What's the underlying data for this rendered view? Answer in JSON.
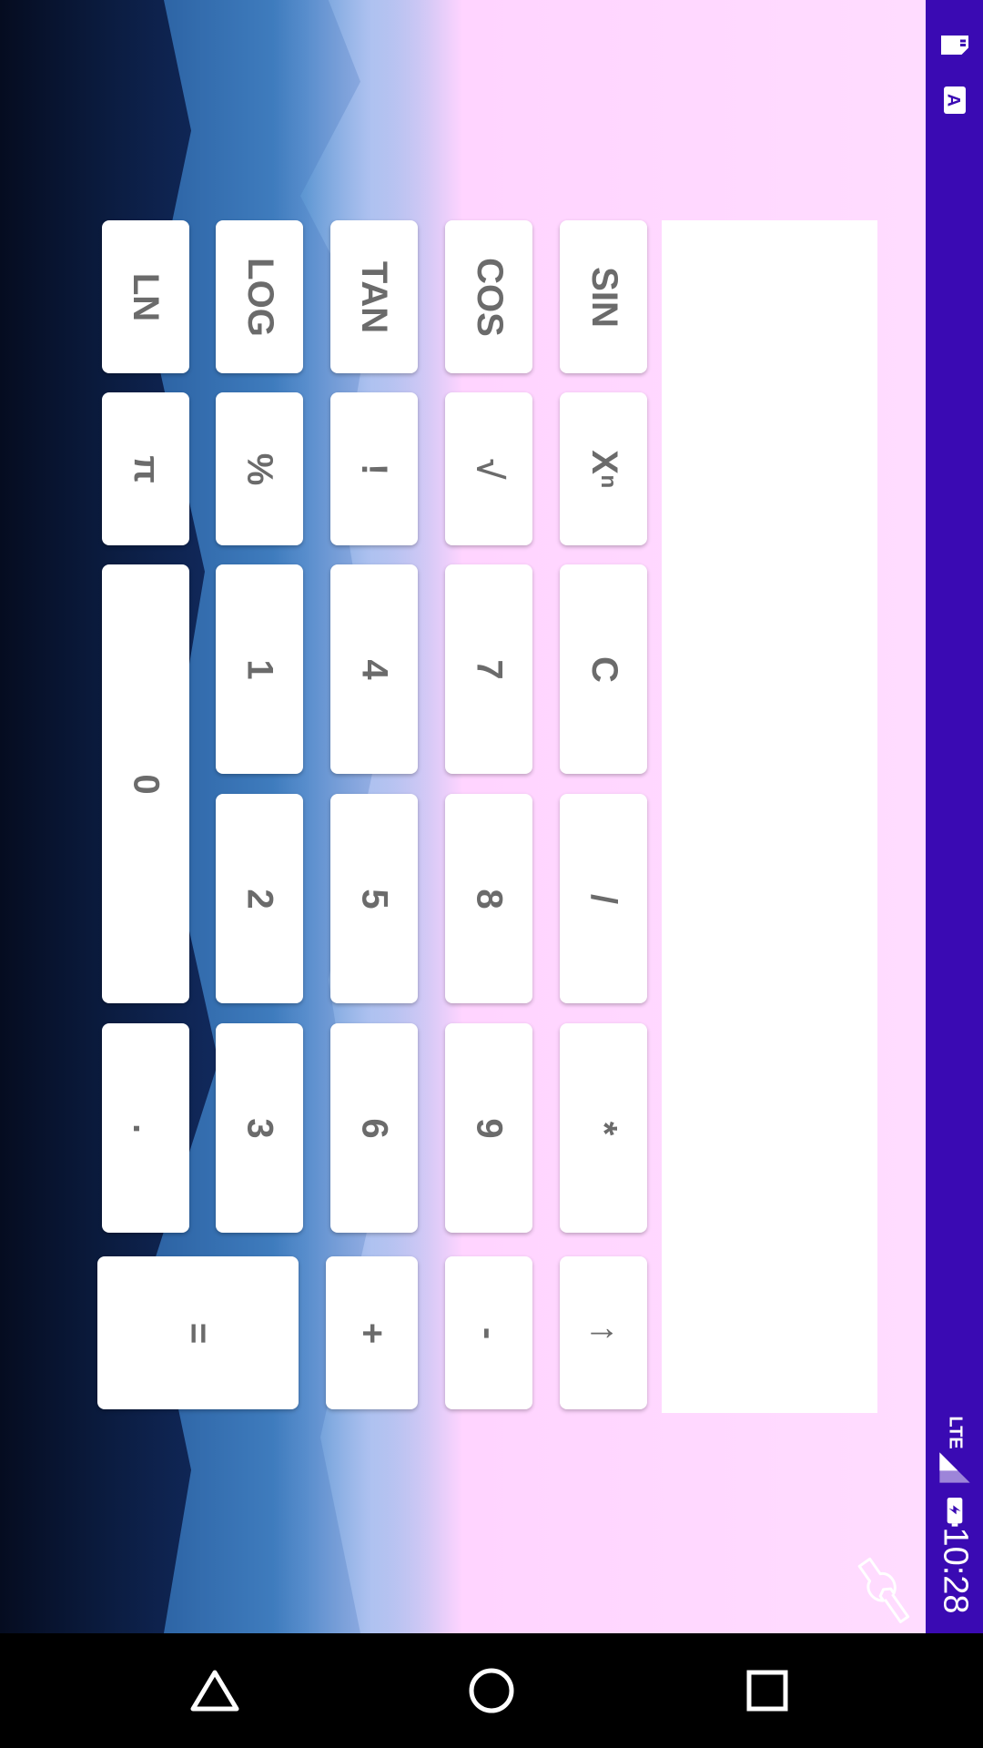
{
  "status_bar": {
    "time": "10:28",
    "network": "LTE"
  },
  "display": {
    "value": ""
  },
  "keys": {
    "sin": "SIN",
    "cos": "COS",
    "tan": "TAN",
    "log": "LOG",
    "ln": "LN",
    "power": "Xⁿ",
    "sqrt": "√",
    "factorial": "!",
    "percent": "%",
    "pi": "π",
    "clear": "C",
    "seven": "7",
    "four": "4",
    "one": "1",
    "zero": "0",
    "divide": "/",
    "eight": "8",
    "five": "5",
    "two": "2",
    "multiply": "*",
    "nine": "9",
    "six": "6",
    "three": "3",
    "dot": ".",
    "backspace": "↑",
    "minus": "-",
    "plus": "+",
    "equals": "="
  },
  "nav": {
    "back": "back-icon",
    "home": "home-icon",
    "recents": "recents-icon"
  },
  "colors": {
    "status_bar": "#3a0ab3",
    "key_text": "#6b6b6b"
  }
}
